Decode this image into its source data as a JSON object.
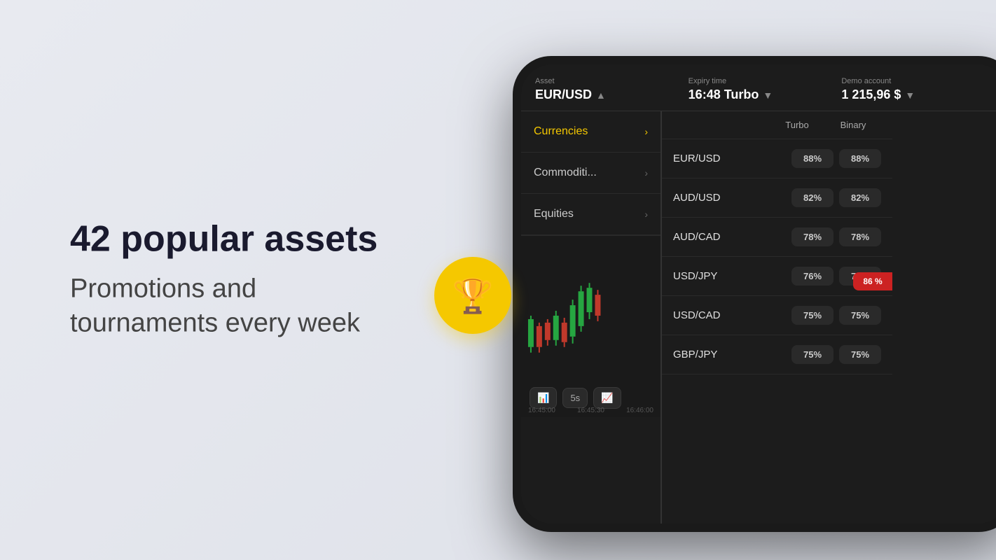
{
  "left": {
    "heading_bold": "42 popular assets",
    "heading_sub_line1": "Promotions and",
    "heading_sub_line2": "tournaments every week"
  },
  "header": {
    "asset_label": "Asset",
    "asset_value": "EUR/USD",
    "expiry_label": "Expiry time",
    "expiry_value": "16:48 Turbo",
    "account_label": "Demo account",
    "account_value": "1 215,96 $"
  },
  "categories": [
    {
      "label": "Currencies",
      "active": true
    },
    {
      "label": "Commoditi...",
      "active": false
    },
    {
      "label": "Equities",
      "active": false
    }
  ],
  "asset_table": {
    "col1": "Turbo",
    "col2": "Binary",
    "rows": [
      {
        "name": "EUR/USD",
        "turbo": "88%",
        "binary": "88%"
      },
      {
        "name": "AUD/USD",
        "turbo": "82%",
        "binary": "82%"
      },
      {
        "name": "AUD/CAD",
        "turbo": "78%",
        "binary": "78%"
      },
      {
        "name": "USD/JPY",
        "turbo": "76%",
        "binary": "76%"
      },
      {
        "name": "USD/CAD",
        "turbo": "75%",
        "binary": "75%"
      },
      {
        "name": "GBP/JPY",
        "turbo": "75%",
        "binary": "75%"
      }
    ]
  },
  "chart": {
    "btn1_label": "5s",
    "time1": "16:45:00",
    "time2": "16:45:30",
    "time3": "16:46:00"
  },
  "side_badge": "86 %"
}
